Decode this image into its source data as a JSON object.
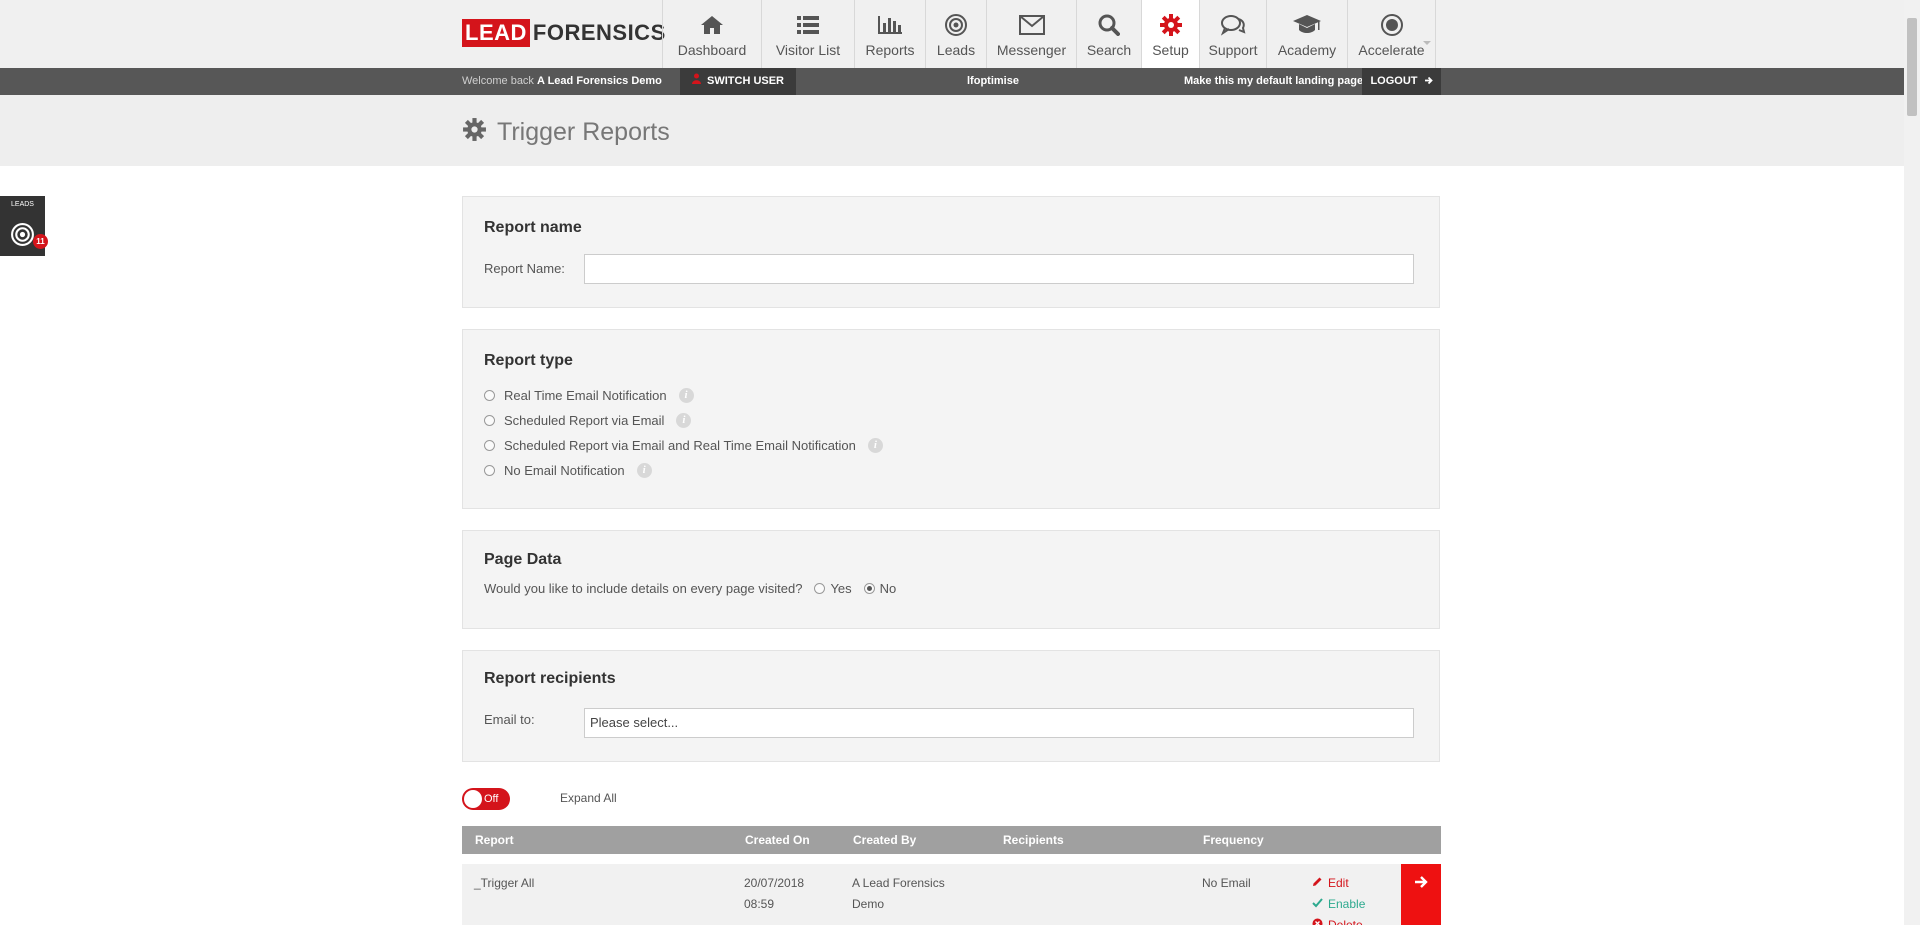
{
  "brand": {
    "lead": "LEAD",
    "forensics": "FORENSICS",
    "accent": "#d4141b"
  },
  "nav": {
    "dashboard": "Dashboard",
    "visitor_list": "Visitor List",
    "reports": "Reports",
    "leads": "Leads",
    "messenger": "Messenger",
    "search": "Search",
    "setup": "Setup",
    "support": "Support",
    "academy": "Academy",
    "accelerate": "Accelerate"
  },
  "subbar": {
    "welcome_prefix": "Welcome back",
    "user": "A Lead Forensics Demo",
    "switch_user": "SWITCH USER",
    "optimise": "lfoptimise",
    "default_landing": "Make this my default landing page",
    "logout": "LOGOUT"
  },
  "page": {
    "title": "Trigger Reports"
  },
  "leads_widget": {
    "label": "LEADS",
    "count": "11"
  },
  "report_name": {
    "title": "Report name",
    "label": "Report Name:",
    "value": ""
  },
  "report_type": {
    "title": "Report type",
    "options": [
      {
        "label": "Real Time Email Notification",
        "checked": false
      },
      {
        "label": "Scheduled Report via Email",
        "checked": false
      },
      {
        "label": "Scheduled Report via Email and Real Time Email Notification",
        "checked": false
      },
      {
        "label": "No Email Notification",
        "checked": false
      }
    ]
  },
  "page_data": {
    "title": "Page Data",
    "question": "Would you like to include details on every page visited?",
    "yes": "Yes",
    "no": "No",
    "selected": "No"
  },
  "recipients": {
    "title": "Report recipients",
    "label": "Email to:",
    "placeholder": "Please select..."
  },
  "controls": {
    "toggle": "Off",
    "expand_all": "Expand All"
  },
  "table": {
    "headers": [
      "Report",
      "Created On",
      "Created By",
      "Recipients",
      "Frequency"
    ],
    "rows": [
      {
        "report": "_Trigger All",
        "created_date": "20/07/2018",
        "created_time": "08:59",
        "created_by_1": "A Lead Forensics",
        "created_by_2": "Demo",
        "recipients": "",
        "frequency": "No Email",
        "edit": "Edit",
        "enable": "Enable",
        "delete": "Delete"
      }
    ]
  }
}
